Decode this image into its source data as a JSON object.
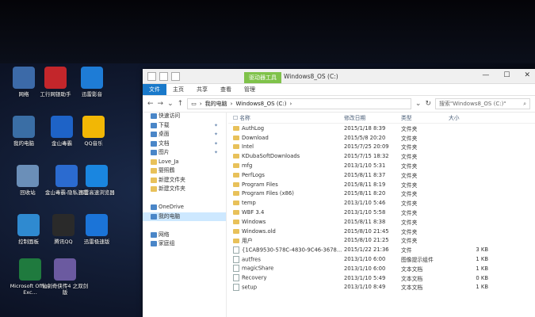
{
  "desktop": {
    "icons": [
      {
        "label": "网络",
        "icon": "network-icon",
        "color": "#3c6aa8"
      },
      {
        "label": "工行网银助手",
        "icon": "icbc-icon",
        "color": "#c3262b"
      },
      {
        "label": "迅雷影音",
        "icon": "thunder-player-icon",
        "color": "#1e7cd6"
      },
      {
        "label": "我的电脑",
        "icon": "computer-icon",
        "color": "#3a6ea5"
      },
      {
        "label": "金山毒霸",
        "icon": "duba-icon",
        "color": "#1e63c7"
      },
      {
        "label": "QQ音乐",
        "icon": "qqmusic-icon",
        "color": "#f2b705"
      },
      {
        "label": "回收站",
        "icon": "recycle-bin-icon",
        "color": "#6b8fb8"
      },
      {
        "label": "金山毒霸-隐私清理",
        "icon": "privacy-clean-icon",
        "color": "#2b6bd0"
      },
      {
        "label": "迅雷高速浏览器",
        "icon": "browser-icon",
        "color": "#1a86e0"
      },
      {
        "label": "控制面板",
        "icon": "control-panel-icon",
        "color": "#2f8ad0"
      },
      {
        "label": "腾讯QQ",
        "icon": "qq-icon",
        "color": "#2a2a2a"
      },
      {
        "label": "迅雷极速版",
        "icon": "thunder-icon",
        "color": "#1b74d8"
      },
      {
        "label": "Microsoft Office Exc...",
        "icon": "excel-icon",
        "color": "#1f7a3e"
      },
      {
        "label": "仙剑奇侠传4 之双剑版",
        "icon": "game-icon",
        "color": "#6b5aa0"
      }
    ]
  },
  "window": {
    "tool_tab": "驱动器工具",
    "title": "Windows8_OS (C:)",
    "controls": {
      "minimize": "—",
      "maximize": "☐",
      "close": "✕"
    },
    "ribbon_tabs": [
      "文件",
      "主页",
      "共享",
      "查看",
      "管理"
    ],
    "address": {
      "root": "我的电脑",
      "current": "Windows8_OS (C:)"
    },
    "search_placeholder": "搜索\"Windows8_OS (C:)\"",
    "nav_pane": [
      {
        "label": "快速访问",
        "icon": "star-icon",
        "pinned": false
      },
      {
        "label": "下载",
        "icon": "download-icon",
        "pinned": true
      },
      {
        "label": "桌面",
        "icon": "desktop-icon",
        "pinned": true
      },
      {
        "label": "文档",
        "icon": "documents-icon",
        "pinned": true
      },
      {
        "label": "图片",
        "icon": "pictures-icon",
        "pinned": true
      },
      {
        "label": "Love_Ja",
        "icon": "folder-icon",
        "pinned": false
      },
      {
        "label": "婴照鶴",
        "icon": "folder-icon",
        "pinned": false
      },
      {
        "label": "新建文件夹",
        "icon": "folder-icon",
        "pinned": false
      },
      {
        "label": "新建文件夹",
        "icon": "folder-icon",
        "pinned": false
      },
      {
        "label": "",
        "icon": "",
        "pinned": false
      },
      {
        "label": "OneDrive",
        "icon": "onedrive-icon",
        "pinned": false
      },
      {
        "label": "我的电脑",
        "icon": "computer-icon",
        "pinned": false
      },
      {
        "label": "",
        "icon": "",
        "pinned": false
      },
      {
        "label": "网络",
        "icon": "network-icon",
        "pinned": false
      },
      {
        "label": "家庭组",
        "icon": "homegroup-icon",
        "pinned": false
      }
    ],
    "columns": {
      "name": "名称",
      "date": "修改日期",
      "type": "类型",
      "size": "大小"
    },
    "files": [
      {
        "name": "AuthLog",
        "date": "2015/1/18 8:39",
        "type": "文件夹",
        "size": "",
        "kind": "folder"
      },
      {
        "name": "Download",
        "date": "2015/5/8 20:20",
        "type": "文件夹",
        "size": "",
        "kind": "folder"
      },
      {
        "name": "Intel",
        "date": "2015/7/25 20:09",
        "type": "文件夹",
        "size": "",
        "kind": "folder"
      },
      {
        "name": "KDubaSoftDownloads",
        "date": "2015/7/15 18:32",
        "type": "文件夹",
        "size": "",
        "kind": "folder"
      },
      {
        "name": "mfg",
        "date": "2013/1/10 5:31",
        "type": "文件夹",
        "size": "",
        "kind": "folder"
      },
      {
        "name": "PerfLogs",
        "date": "2015/8/11 8:37",
        "type": "文件夹",
        "size": "",
        "kind": "folder"
      },
      {
        "name": "Program Files",
        "date": "2015/8/11 8:19",
        "type": "文件夹",
        "size": "",
        "kind": "folder"
      },
      {
        "name": "Program Files (x86)",
        "date": "2015/8/11 8:20",
        "type": "文件夹",
        "size": "",
        "kind": "folder"
      },
      {
        "name": "temp",
        "date": "2013/1/10 5:46",
        "type": "文件夹",
        "size": "",
        "kind": "folder"
      },
      {
        "name": "WBF 3.4",
        "date": "2013/1/10 5:58",
        "type": "文件夹",
        "size": "",
        "kind": "folder"
      },
      {
        "name": "Windows",
        "date": "2015/8/11 8:38",
        "type": "文件夹",
        "size": "",
        "kind": "folder"
      },
      {
        "name": "Windows.old",
        "date": "2015/8/10 21:45",
        "type": "文件夹",
        "size": "",
        "kind": "folder"
      },
      {
        "name": "用户",
        "date": "2015/8/10 21:25",
        "type": "文件夹",
        "size": "",
        "kind": "folder"
      },
      {
        "name": "{1CAB9530-578C-4830-9C46-3678...",
        "date": "2015/1/22 21:36",
        "type": "文件",
        "size": "3 KB",
        "kind": "file"
      },
      {
        "name": "autfres",
        "date": "2013/1/10 6:00",
        "type": "图像提示组件",
        "size": "1 KB",
        "kind": "file"
      },
      {
        "name": "magicShare",
        "date": "2013/1/10 6:00",
        "type": "文本文档",
        "size": "1 KB",
        "kind": "file"
      },
      {
        "name": "Recovery",
        "date": "2013/1/10 5:49",
        "type": "文本文档",
        "size": "0 KB",
        "kind": "file"
      },
      {
        "name": "setup",
        "date": "2013/1/10 8:49",
        "type": "文本文档",
        "size": "1 KB",
        "kind": "file"
      }
    ]
  }
}
